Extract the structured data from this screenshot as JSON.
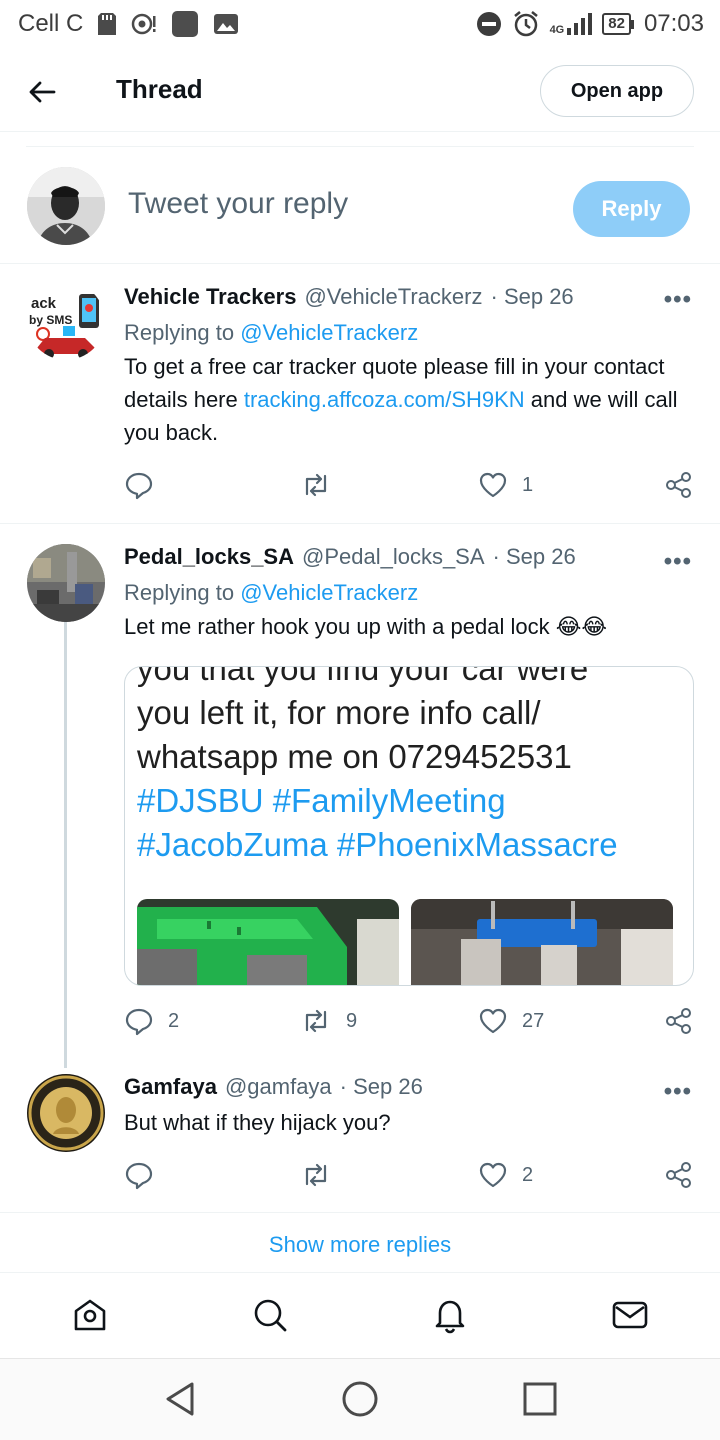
{
  "status_bar": {
    "carrier": "Cell C",
    "network": "4G",
    "battery": "82",
    "time": "07:03"
  },
  "header": {
    "title": "Thread",
    "open_app_label": "Open app"
  },
  "compose": {
    "placeholder": "Tweet your reply",
    "reply_label": "Reply"
  },
  "tweets": [
    {
      "name": "Vehicle Trackers",
      "handle": "@VehicleTrackerz",
      "date": "· Sep 26",
      "replying_prefix": "Replying to",
      "replying_to": "@VehicleTrackerz",
      "text_1": "To get a free car tracker quote please fill in your contact details here ",
      "link": "tracking.affcoza.com/SH9KN",
      "text_2": " and we will call you back.",
      "replies": "",
      "retweets": "",
      "likes": "1"
    },
    {
      "name": "Pedal_locks_SA",
      "handle": "@Pedal_locks_SA",
      "date": "· Sep 26",
      "replying_prefix": "Replying to",
      "replying_to": "@VehicleTrackerz",
      "text": "Let me rather hook you up with a pedal lock 😂😂",
      "card": {
        "line_1": "you that you find your car were",
        "line_2": "you left it, for more info call/",
        "line_3": "whatsapp me on 0729452531",
        "tags_1": "#DJSBU #FamilyMeeting",
        "tags_2": "#JacobZuma #PhoenixMassacre"
      },
      "replies": "2",
      "retweets": "9",
      "likes": "27"
    },
    {
      "name": "Gamfaya",
      "handle": "@gamfaya",
      "date": "· Sep 26",
      "text": "But what if they hijack you?",
      "replies": "",
      "retweets": "",
      "likes": "2"
    }
  ],
  "show_more": "Show more replies",
  "colors": {
    "accent": "#1d9bf0",
    "reply_button_disabled": "#8ecdf8",
    "secondary_text": "#536471"
  },
  "icons": {
    "back": "arrow-left-icon",
    "reply": "comment-icon",
    "retweet": "retweet-icon",
    "like": "heart-icon",
    "share": "share-icon",
    "nav": [
      "home-icon",
      "search-icon",
      "bell-icon",
      "mail-icon"
    ],
    "system": [
      "back-triangle-icon",
      "home-circle-icon",
      "recents-square-icon"
    ]
  }
}
